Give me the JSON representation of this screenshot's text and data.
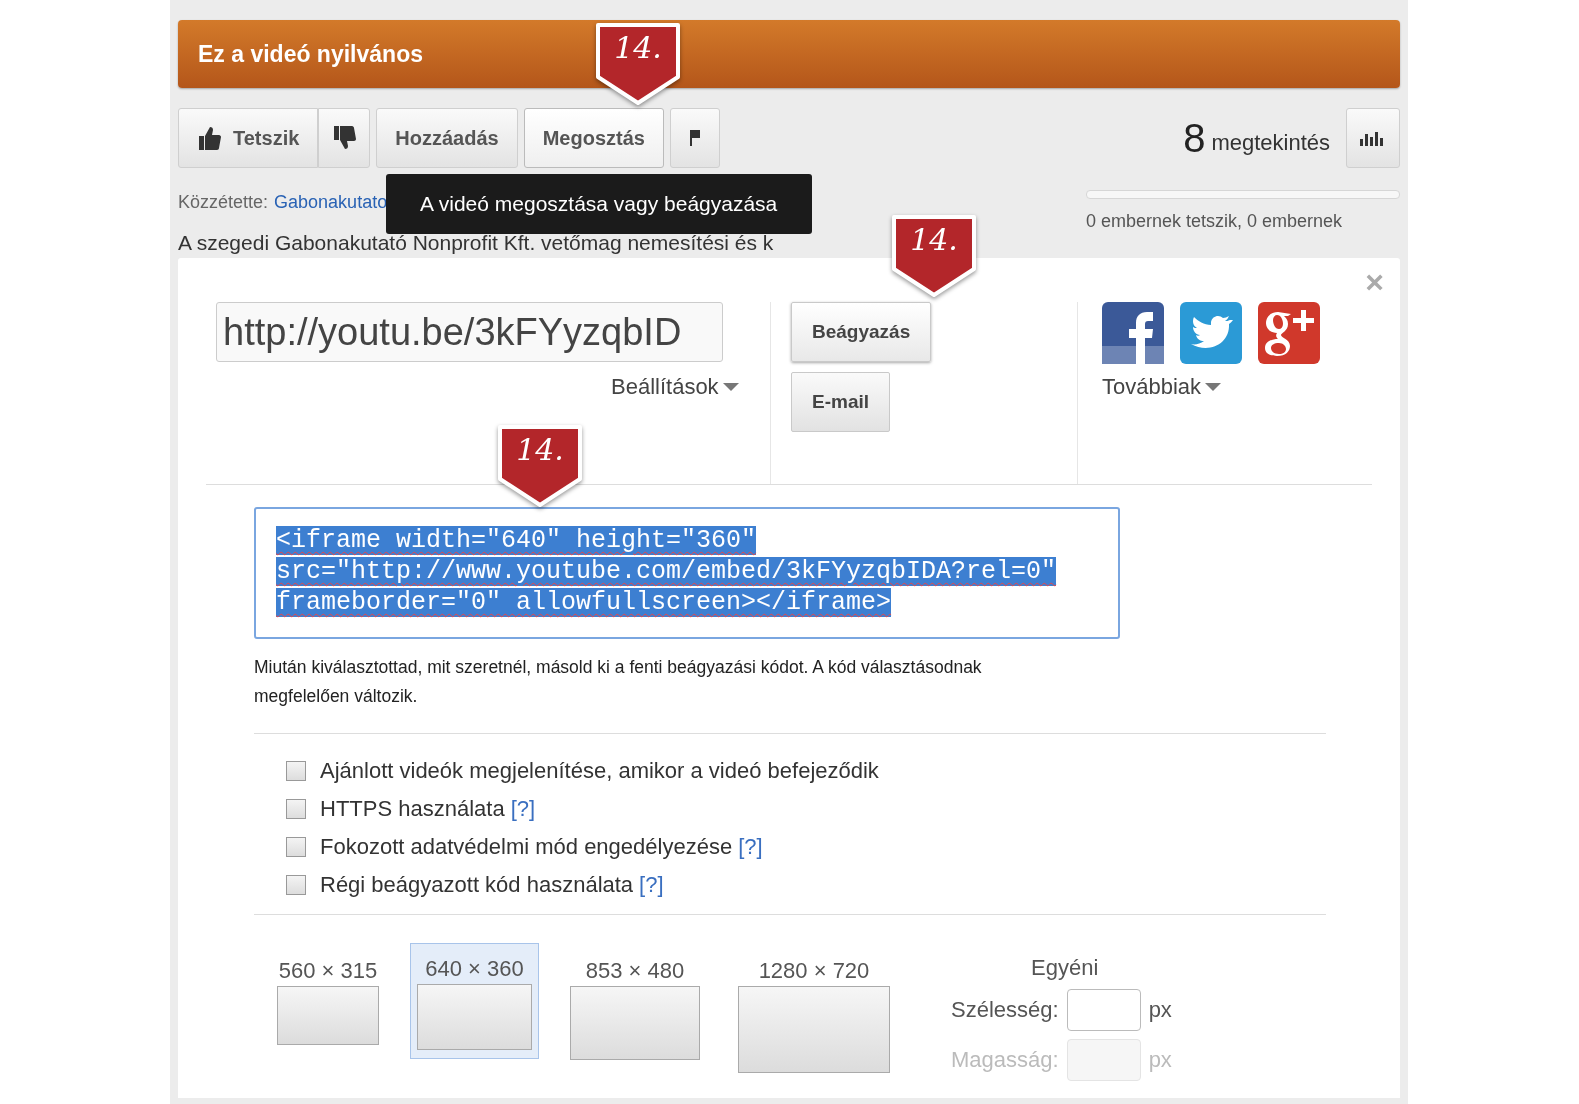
{
  "header": {
    "title": "Ez a videó nyilvános"
  },
  "actions": [
    {
      "kind": "like",
      "label": "Tetszik",
      "selected": false
    },
    {
      "kind": "dislike",
      "selected": false
    },
    {
      "kind": "text",
      "label": "Hozzáadás",
      "selected": false
    },
    {
      "kind": "text",
      "label": "Megosztás",
      "selected": true
    },
    {
      "kind": "flag",
      "selected": false
    }
  ],
  "views": {
    "count": "8",
    "label": "megtekintés"
  },
  "tooltip": "A videó megosztása vagy beágyazása",
  "publisher": {
    "label": "Közzétette:",
    "name": "Gabonakutato"
  },
  "likes": {
    "text": "0 embernek tetszik, 0 embernek"
  },
  "description": "A szegedi Gabonakutató Nonprofit Kft. vetőmag nemesítési és k",
  "share": {
    "close": "×",
    "url": "http://youtu.be/3kFYyzqbID",
    "settings": "Beállítások",
    "modes": [
      {
        "label": "Beágyazás",
        "selected": true
      },
      {
        "label": "E-mail",
        "selected": false
      }
    ],
    "social": [
      {
        "kind": "facebook"
      },
      {
        "kind": "twitter"
      },
      {
        "kind": "googleplus"
      }
    ],
    "more": "Továbbiak"
  },
  "embed": {
    "code_lines": [
      "<iframe width=\"640\" height=\"360\"",
      "src=\"http://www.youtube.com/embed/3kFYyzqbIDA?rel=0\"",
      "frameborder=\"0\" allowfullscreen></iframe>"
    ],
    "help": "Miután kiválasztottad, mit szeretnél, másold ki a fenti beágyazási kódot. A kód választásodnak megfelelően változik."
  },
  "options": [
    {
      "label": "Ajánlott videók megjelenítése, amikor a videó befejeződik",
      "checked": false
    },
    {
      "label": "HTTPS használata",
      "help": "[?]",
      "checked": false
    },
    {
      "label": "Fokozott adatvédelmi mód engedélyezése",
      "help": "[?]",
      "checked": false
    },
    {
      "label": "Régi beágyazott kód használata",
      "help": "[?]",
      "checked": false
    }
  ],
  "sizes": [
    {
      "label": "560 × 315",
      "selected": false
    },
    {
      "label": "640 × 360",
      "selected": true
    },
    {
      "label": "853 × 480",
      "selected": false
    },
    {
      "label": "1280 × 720",
      "selected": false
    }
  ],
  "custom": {
    "title": "Egyéni",
    "fields": [
      {
        "label": "Szélesség:",
        "unit": "px",
        "disabled": false
      },
      {
        "label": "Magasság:",
        "unit": "px",
        "disabled": true
      }
    ]
  },
  "callouts": [
    {
      "text": "14."
    },
    {
      "text": "14."
    },
    {
      "text": "14."
    }
  ]
}
